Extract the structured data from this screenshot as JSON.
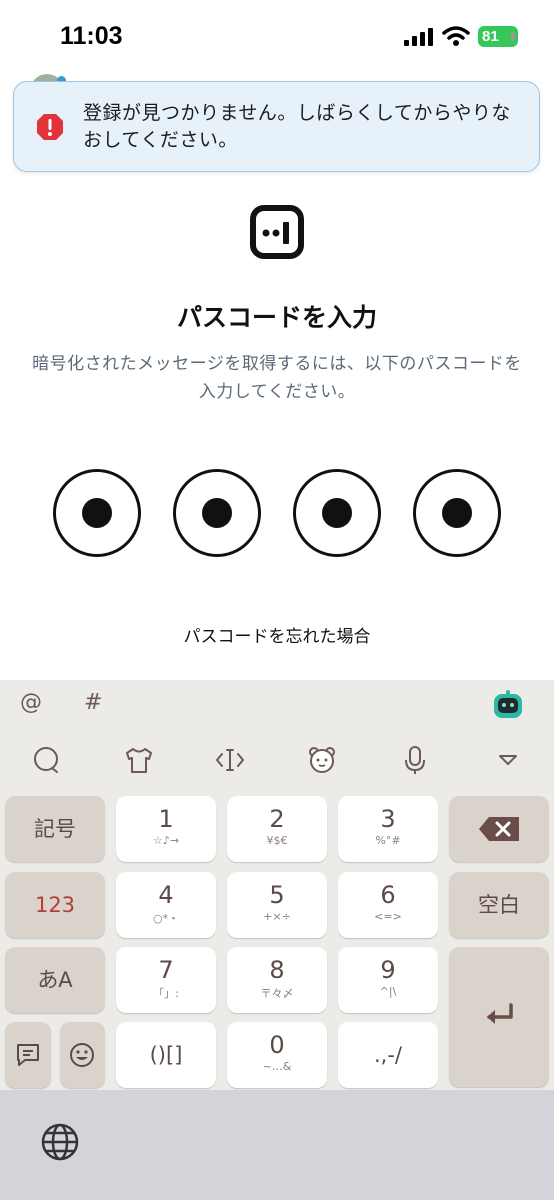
{
  "status_bar": {
    "time": "11:03",
    "battery": "81"
  },
  "banner": {
    "icon": "alert-octagon-icon",
    "message": "登録が見つかりません。しばらくしてからやりなおしてください。"
  },
  "logo": {
    "icon": "app-logo-icon"
  },
  "title": "パスコードを入力",
  "description": "暗号化されたメッセージを取得するには、以下のパスコードを入力してください。",
  "passcode": {
    "length": 4,
    "filled": 4
  },
  "forgot_link": "パスコードを忘れた場合",
  "keyboard": {
    "suggestions": [
      "@",
      "#"
    ],
    "keys": {
      "symbols": "記号",
      "numeric": "123",
      "kana": "あA",
      "space": "空白",
      "k1": {
        "main": "1",
        "sub": "☆♪→"
      },
      "k2": {
        "main": "2",
        "sub": "¥$€"
      },
      "k3": {
        "main": "3",
        "sub": "%°#"
      },
      "k4": {
        "main": "4",
        "sub": "○*・"
      },
      "k5": {
        "main": "5",
        "sub": "+×÷"
      },
      "k6": {
        "main": "6",
        "sub": "<=>"
      },
      "k7": {
        "main": "7",
        "sub": "「」:"
      },
      "k8": {
        "main": "8",
        "sub": "〒々〆"
      },
      "k9": {
        "main": "9",
        "sub": "^|\\"
      },
      "k0": {
        "main": "0",
        "sub": "~…&"
      },
      "brackets": "()[]",
      "punct": ".,-/"
    }
  },
  "colors": {
    "banner_bg": "#e6f1fa",
    "alert": "#e0343a",
    "battery": "#35c759",
    "key_text": "#5c4a46",
    "numeric_key": "#b23d3b"
  }
}
